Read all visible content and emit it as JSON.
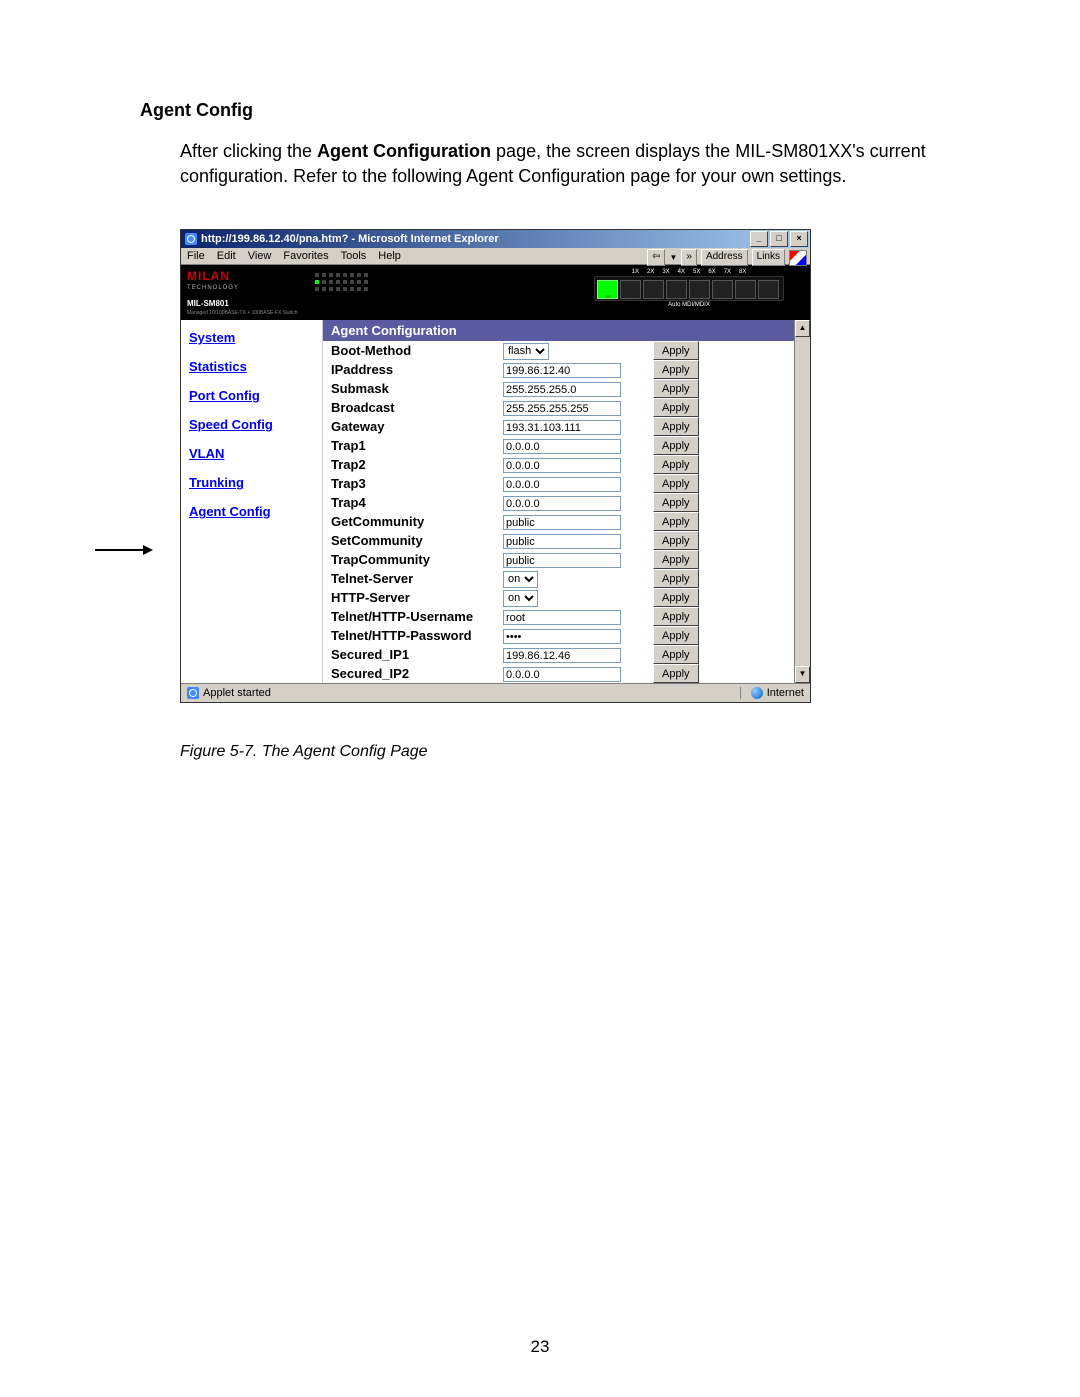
{
  "heading": "Agent Config",
  "paragraph_before_bold": "After clicking the ",
  "paragraph_bold": "Agent Configuration",
  "paragraph_after_bold": " page, the screen displays the MIL-SM801XX's current configuration. Refer to the following Agent Configuration page for your own settings.",
  "browser": {
    "title": "http://199.86.12.40/pna.htm? - Microsoft Internet Explorer",
    "menus": [
      "File",
      "Edit",
      "View",
      "Favorites",
      "Tools",
      "Help"
    ],
    "toolbar_address_label": "Address",
    "toolbar_links_label": "Links",
    "back_glyph": "⇦",
    "more_glyph": "»"
  },
  "device": {
    "brand": "MILAN",
    "brand_sub": "TECHNOLOGY",
    "model": "MIL-SM801",
    "desc": "Managed 10/100BASE-TX + 100BASE-FX Switch",
    "port_labels": [
      "1X",
      "2X",
      "3X",
      "4X",
      "5X",
      "6X",
      "7X",
      "8X"
    ],
    "port_caption": "Auto MDI/MDIX"
  },
  "sidebar": {
    "items": [
      "System",
      "Statistics",
      "Port Config",
      "Speed Config",
      "VLAN",
      "Trunking",
      "Agent Config"
    ]
  },
  "panel": {
    "title": "Agent Configuration",
    "apply_label": "Apply",
    "rows": [
      {
        "label": "Boot-Method",
        "type": "select",
        "value": "flash"
      },
      {
        "label": "IPaddress",
        "type": "text",
        "value": "199.86.12.40"
      },
      {
        "label": "Submask",
        "type": "text",
        "value": "255.255.255.0"
      },
      {
        "label": "Broadcast",
        "type": "text",
        "value": "255.255.255.255"
      },
      {
        "label": "Gateway",
        "type": "text",
        "value": "193.31.103.111"
      },
      {
        "label": "Trap1",
        "type": "text",
        "value": "0.0.0.0"
      },
      {
        "label": "Trap2",
        "type": "text",
        "value": "0.0.0.0"
      },
      {
        "label": "Trap3",
        "type": "text",
        "value": "0.0.0.0"
      },
      {
        "label": "Trap4",
        "type": "text",
        "value": "0.0.0.0"
      },
      {
        "label": "GetCommunity",
        "type": "text",
        "value": "public"
      },
      {
        "label": "SetCommunity",
        "type": "text",
        "value": "public"
      },
      {
        "label": "TrapCommunity",
        "type": "text",
        "value": "public"
      },
      {
        "label": "Telnet-Server",
        "type": "select",
        "value": "on"
      },
      {
        "label": "HTTP-Server",
        "type": "select",
        "value": "on"
      },
      {
        "label": "Telnet/HTTP-Username",
        "type": "text",
        "value": "root"
      },
      {
        "label": "Telnet/HTTP-Password",
        "type": "password",
        "value": "****"
      },
      {
        "label": "Secured_IP1",
        "type": "text",
        "value": "199.86.12.46"
      },
      {
        "label": "Secured_IP2",
        "type": "text",
        "value": "0.0.0.0"
      }
    ]
  },
  "status": {
    "left": "Applet started",
    "right": "Internet"
  },
  "figure_caption": "Figure 5-7. The Agent Config Page",
  "page_number": "23"
}
